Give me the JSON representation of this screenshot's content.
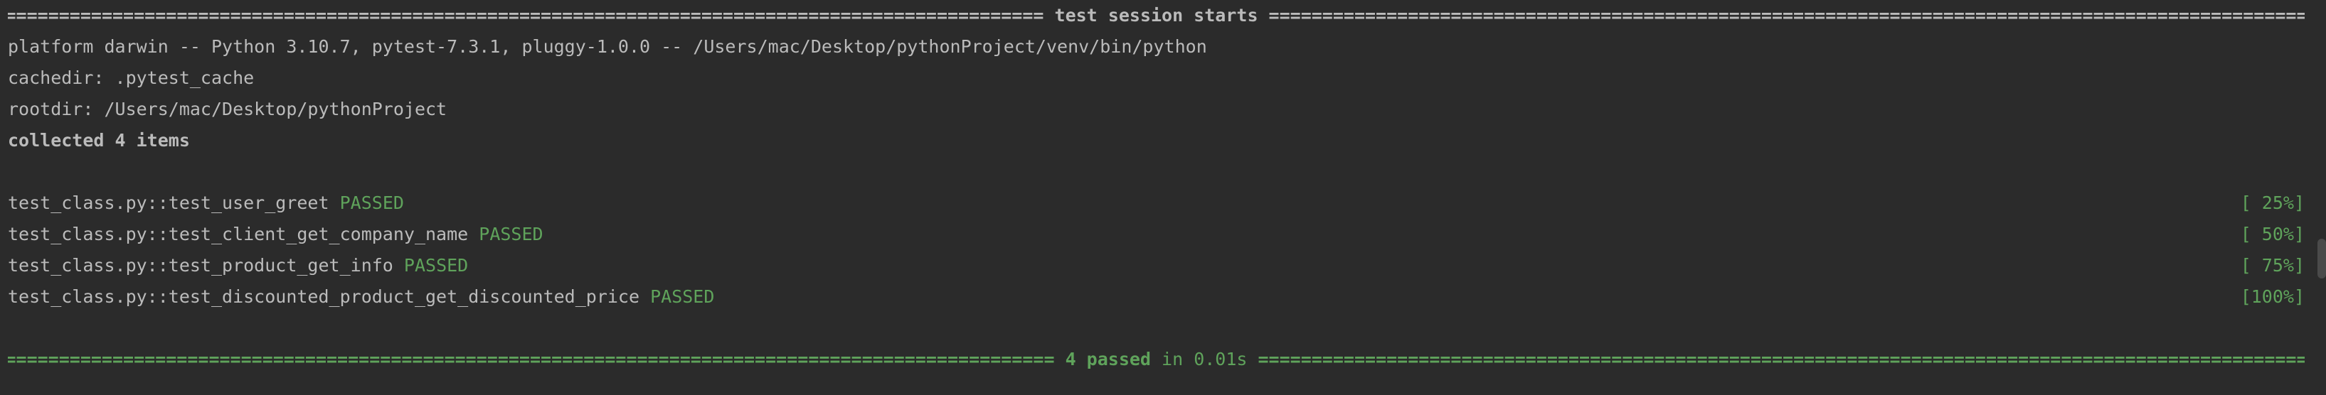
{
  "session_header": {
    "title": " test session starts ",
    "fill": "=========================================================================================================================================================================================================="
  },
  "platform_line": "platform darwin -- Python 3.10.7, pytest-7.3.1, pluggy-1.0.0 -- /Users/mac/Desktop/pythonProject/venv/bin/python",
  "cachedir_line": "cachedir: .pytest_cache",
  "rootdir_line": "rootdir: /Users/mac/Desktop/pythonProject",
  "collected_line": "collected 4 items",
  "tests": [
    {
      "name": "test_class.py::test_user_greet",
      "status": "PASSED",
      "progress": "[ 25%]"
    },
    {
      "name": "test_class.py::test_client_get_company_name",
      "status": "PASSED",
      "progress": "[ 50%]"
    },
    {
      "name": "test_class.py::test_product_get_info",
      "status": "PASSED",
      "progress": "[ 75%]"
    },
    {
      "name": "test_class.py::test_discounted_product_get_discounted_price",
      "status": "PASSED",
      "progress": "[100%]"
    }
  ],
  "summary": {
    "count": "4 passed",
    "time": " in 0.01s "
  },
  "colors": {
    "background": "#2b2b2b",
    "text": "#bbbbbb",
    "passed": "#5fa35b"
  }
}
